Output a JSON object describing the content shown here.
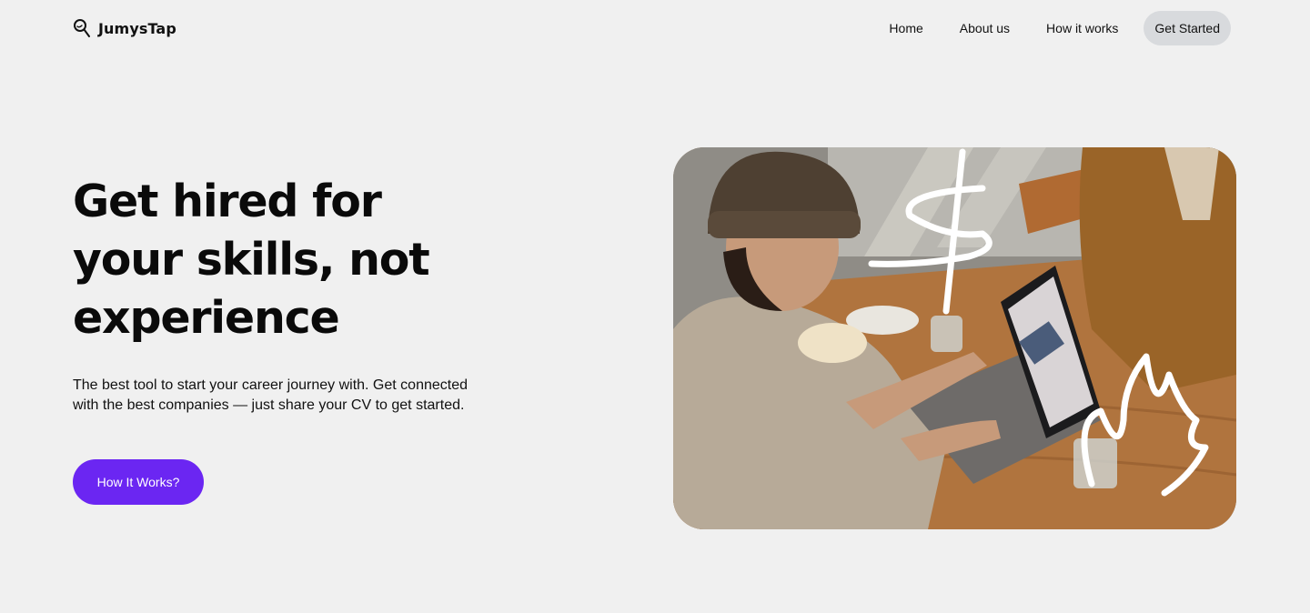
{
  "header": {
    "brand": {
      "name": "JumysTap",
      "icon": "search-logo-icon"
    },
    "nav": [
      {
        "label": "Home"
      },
      {
        "label": "About us"
      },
      {
        "label": "How it works"
      },
      {
        "label": "Get Started",
        "active": true
      }
    ]
  },
  "hero": {
    "title_lines": [
      "Get hired for",
      "your skills, not",
      "experience"
    ],
    "subtitle_lines": [
      "The best tool to start your career journey with. Get connected",
      "with the best companies — just share your CV to get started."
    ],
    "cta_label": "How It Works?",
    "image": {
      "description_icon": "hero-photo"
    }
  },
  "colors": {
    "background": "#f0f0f0",
    "cta": "#6b26f2",
    "nav_active_bg": "#d8dadd",
    "text": "#111111"
  }
}
